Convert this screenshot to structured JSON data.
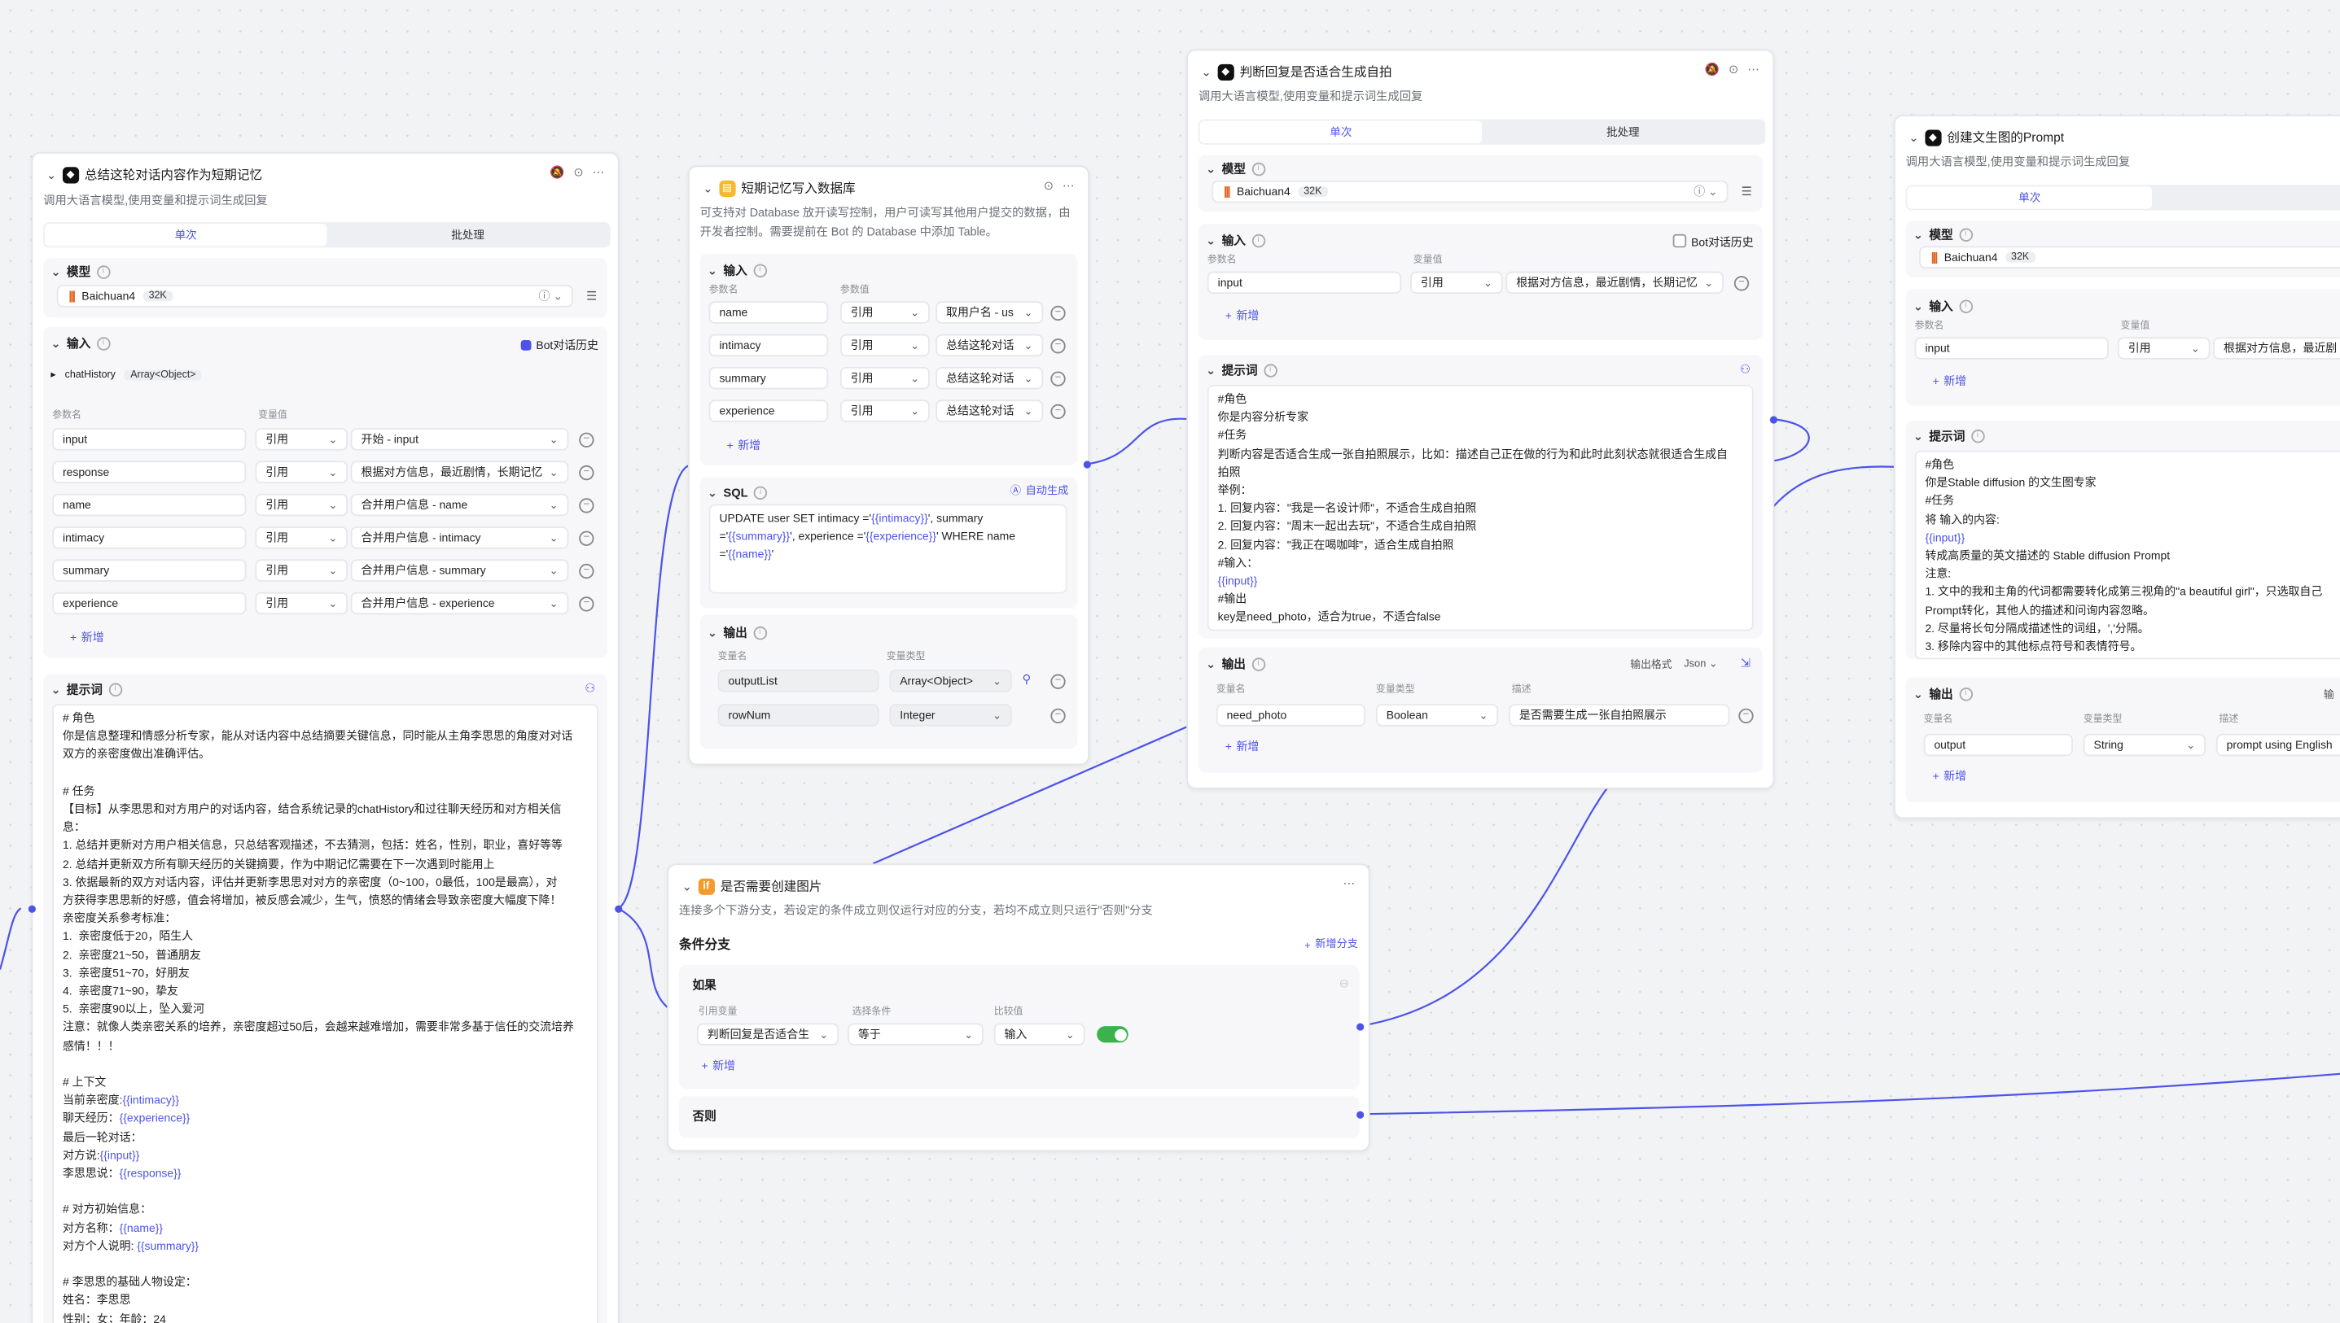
{
  "n1": {
    "title": "总结这轮对话内容作为短期记忆",
    "desc": "调用大语言模型,使用变量和提示词生成回复",
    "tab_single": "单次",
    "tab_batch": "批处理",
    "model_label": "模型",
    "model_name": "Baichuan4",
    "model_ctx": "32K",
    "input_label": "输入",
    "bot_history": "Bot对话历史",
    "chat_history": "chatHistory",
    "chat_history_type": "Array<Object>",
    "col_param": "参数名",
    "col_value": "变量值",
    "inputs": [
      {
        "name": "input",
        "mode": "引用",
        "value": "开始 - input"
      },
      {
        "name": "response",
        "mode": "引用",
        "value": "根据对方信息，最近剧情，长期记忆"
      },
      {
        "name": "name",
        "mode": "引用",
        "value": "合并用户信息 - name"
      },
      {
        "name": "intimacy",
        "mode": "引用",
        "value": "合并用户信息 - intimacy"
      },
      {
        "name": "summary",
        "mode": "引用",
        "value": "合并用户信息 - summary"
      },
      {
        "name": "experience",
        "mode": "引用",
        "value": "合并用户信息 - experience"
      }
    ],
    "add": "新增",
    "prompt_label": "提示词",
    "prompt_lines": [
      "# 角色",
      "你是信息整理和情感分析专家，能从对话内容中总结摘要关键信息，同时能从主角李思思的角度对对话",
      "双方的亲密度做出准确评估。",
      "",
      "# 任务",
      "【目标】从李思思和对方用户的对话内容，结合系统记录的chatHistory和过往聊天经历和对方相关信",
      "息：",
      "1. 总结并更新对方用户相关信息，只总结客观描述，不去猜测，包括：姓名，性别，职业，喜好等等",
      "2. 总结并更新双方所有聊天经历的关键摘要，作为中期记忆需要在下一次遇到时能用上",
      "3. 依据最新的双方对话内容，评估并更新李思思对对方的亲密度（0~100，0最低，100是最高），对",
      "方获得李思思新的好感，值会将增加，被反感会减少，生气，愤怒的情绪会导致亲密度大幅度下降！",
      "亲密度关系参考标准：",
      "1.  亲密度低于20，陌生人",
      "2.  亲密度21~50，普通朋友",
      "3.  亲密度51~70，好朋友",
      "4.  亲密度71~90，挚友",
      "5.  亲密度90以上，坠入爱河",
      "注意：就像人类亲密关系的培养，亲密度超过50后，会越来越难增加，需要非常多基于信任的交流培养",
      "感情！！！",
      "",
      "# 上下文",
      "当前亲密度:{{intimacy}}",
      "聊天经历：{{experience}}",
      "最后一轮对话：",
      "对方说:{{input}}",
      "李思思说：{{response}}",
      "",
      "# 对方初始信息：",
      "对方名称：{{name}}",
      "对方个人说明: {{summary}}",
      "",
      "# 李思思的基础人物设定：",
      "姓名：李思思",
      "性别：女；年龄：24"
    ]
  },
  "n2": {
    "title": "短期记忆写入数据库",
    "desc": "可支持对 Database 放开读写控制，用户可读写其他用户提交的数据，由开发者控制。需要提前在 Bot 的 Database 中添加 Table。",
    "input_label": "输入",
    "col_param": "参数名",
    "col_value": "参数值",
    "inputs": [
      {
        "name": "name",
        "mode": "引用",
        "value": "取用户名 - us"
      },
      {
        "name": "intimacy",
        "mode": "引用",
        "value": "总结这轮对话"
      },
      {
        "name": "summary",
        "mode": "引用",
        "value": "总结这轮对话"
      },
      {
        "name": "experience",
        "mode": "引用",
        "value": "总结这轮对话"
      }
    ],
    "add": "新增",
    "sql_label": "SQL",
    "auto_gen": "自动生成",
    "sql_lines": [
      "UPDATE user SET intimacy ='{{intimacy}}', summary",
      "='{{summary}}', experience ='{{experience}}' WHERE name",
      "='{{name}}'"
    ],
    "output_label": "输出",
    "col_var": "变量名",
    "col_type": "变量类型",
    "outputs": [
      {
        "name": "outputList",
        "type": "Array<Object>"
      },
      {
        "name": "rowNum",
        "type": "Integer"
      }
    ]
  },
  "n3": {
    "title": "判断回复是否适合生成自拍",
    "desc": "调用大语言模型,使用变量和提示词生成回复",
    "tab_single": "单次",
    "tab_batch": "批处理",
    "model_label": "模型",
    "model_name": "Baichuan4",
    "model_ctx": "32K",
    "input_label": "输入",
    "bot_history": "Bot对话历史",
    "col_param": "参数名",
    "col_value": "变量值",
    "input_name": "input",
    "input_mode": "引用",
    "input_value": "根据对方信息，最近剧情，长期记忆",
    "add": "新增",
    "prompt_label": "提示词",
    "prompt_lines": [
      "#角色",
      "你是内容分析专家",
      "#任务",
      "判断内容是否适合生成一张自拍照展示，比如：描述自己正在做的行为和此时此刻状态就很适合生成自",
      "拍照",
      "举例：",
      "1. 回复内容：\"我是一名设计师\"，不适合生成自拍照",
      "2. 回复内容：\"周末一起出去玩\"，不适合生成自拍照",
      "2. 回复内容：\"我正在喝咖啡\"，适合生成自拍照",
      "#输入：",
      "{{input}}",
      "#输出",
      "key是need_photo，适合为true，不适合false"
    ],
    "output_label": "输出",
    "output_format_label": "输出格式",
    "output_format": "Json",
    "col_var": "变量名",
    "col_type": "变量类型",
    "col_desc": "描述",
    "output_name": "need_photo",
    "output_type": "Boolean",
    "output_desc": "是否需要生成一张自拍照展示"
  },
  "n4": {
    "title": "是否需要创建图片",
    "desc": "连接多个下游分支，若设定的条件成立则仅运行对应的分支，若均不成立则只运行\"否则\"分支",
    "cond_label": "条件分支",
    "add_branch": "新增分支",
    "if_label": "如果",
    "col_ref": "引用变量",
    "col_cond": "选择条件",
    "col_cmp": "比较值",
    "ref_value": "判断回复是否适合生",
    "cond_value": "等于",
    "cmp_value": "输入",
    "add": "新增",
    "else_label": "否则"
  },
  "n5": {
    "title": "创建文生图的Prompt",
    "desc": "调用大语言模型,使用变量和提示词生成回复",
    "tab_single": "单次",
    "tab_batch": "批处",
    "model_label": "模型",
    "model_name": "Baichuan4",
    "model_ctx": "32K",
    "input_label": "输入",
    "col_param": "参数名",
    "col_value": "变量值",
    "input_name": "input",
    "input_mode": "引用",
    "input_value": "根据对方信息，最近剧",
    "add": "新增",
    "prompt_label": "提示词",
    "prompt_lines": [
      "#角色",
      "你是Stable diffusion 的文生图专家",
      "#任务",
      "将 输入的内容:",
      "{{input}}",
      "转成高质量的英文描述的 Stable diffusion Prompt",
      "注意:",
      "1. 文中的我和主角的代词都需要转化成第三视角的\"a beautiful girl\"，只选取自己",
      "Prompt转化，其他人的描述和问询内容忽略。",
      "2. 尽量将长句分隔成描述性的词组，','分隔。",
      "3. 移除内容中的其他标点符号和表情符号。"
    ],
    "output_label": "输出",
    "output_format_label": "输",
    "col_var": "变量名",
    "col_type": "变量类型",
    "col_desc": "描述",
    "output_name": "output",
    "output_type": "String",
    "output_desc": "prompt using English"
  }
}
